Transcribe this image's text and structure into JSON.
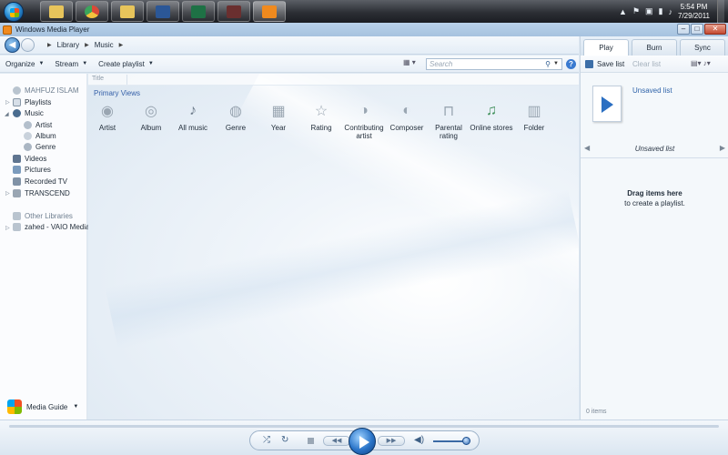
{
  "taskbar": {
    "start": "start-orb",
    "pinned": [
      {
        "name": "explorer",
        "icon": "folder-icon",
        "color": "#e7c45b"
      },
      {
        "name": "chrome",
        "icon": "chrome-icon",
        "color": "#d94a38"
      },
      {
        "name": "explorer2",
        "icon": "folder-icon",
        "color": "#e7c45b"
      },
      {
        "name": "word",
        "icon": "word-icon",
        "color": "#2b5797"
      },
      {
        "name": "excel",
        "icon": "excel-icon",
        "color": "#1e7145"
      },
      {
        "name": "app",
        "icon": "app-icon",
        "color": "#b8392f"
      },
      {
        "name": "wmp",
        "icon": "media-player-icon",
        "color": "#f08a1e"
      }
    ],
    "clock_time": "5:54 PM",
    "clock_date": "7/29/2011"
  },
  "window": {
    "title": "Windows Media Player"
  },
  "nav": {
    "breadcrumb": [
      "Library",
      "Music"
    ]
  },
  "toolbar": {
    "organize": "Organize",
    "stream": "Stream",
    "create_playlist": "Create playlist",
    "search_placeholder": "Search"
  },
  "sidebar": {
    "user": "MAHFUZ ISLAM",
    "items": [
      {
        "label": "Playlists"
      },
      {
        "label": "Music"
      },
      {
        "label": "Artist"
      },
      {
        "label": "Album"
      },
      {
        "label": "Genre"
      },
      {
        "label": "Videos"
      },
      {
        "label": "Pictures"
      },
      {
        "label": "Recorded TV"
      },
      {
        "label": "TRANSCEND"
      }
    ],
    "other_libraries": "Other Libraries",
    "remote_lib": "zahed - VAIO Media",
    "media_guide": "Media Guide"
  },
  "main": {
    "column_header": "Title",
    "section": "Primary Views",
    "views": [
      {
        "label": "Artist",
        "icon": "artist-icon"
      },
      {
        "label": "Album",
        "icon": "album-icon"
      },
      {
        "label": "All music",
        "icon": "music-note-icon"
      },
      {
        "label": "Genre",
        "icon": "genre-icon"
      },
      {
        "label": "Year",
        "icon": "calendar-icon"
      },
      {
        "label": "Rating",
        "icon": "star-icon"
      },
      {
        "label": "Contributing artist",
        "icon": "contributing-artist-icon"
      },
      {
        "label": "Composer",
        "icon": "composer-icon"
      },
      {
        "label": "Parental rating",
        "icon": "lock-icon"
      },
      {
        "label": "Online stores",
        "icon": "online-stores-icon"
      },
      {
        "label": "Folder",
        "icon": "folder-icon"
      }
    ]
  },
  "rpane": {
    "tabs": [
      "Play",
      "Burn",
      "Sync"
    ],
    "save_list": "Save list",
    "clear_list": "Clear list",
    "unsaved_link": "Unsaved list",
    "list_title": "Unsaved list",
    "drag_title": "Drag items here",
    "drag_sub": "to create a playlist.",
    "items_count": "0 items"
  }
}
